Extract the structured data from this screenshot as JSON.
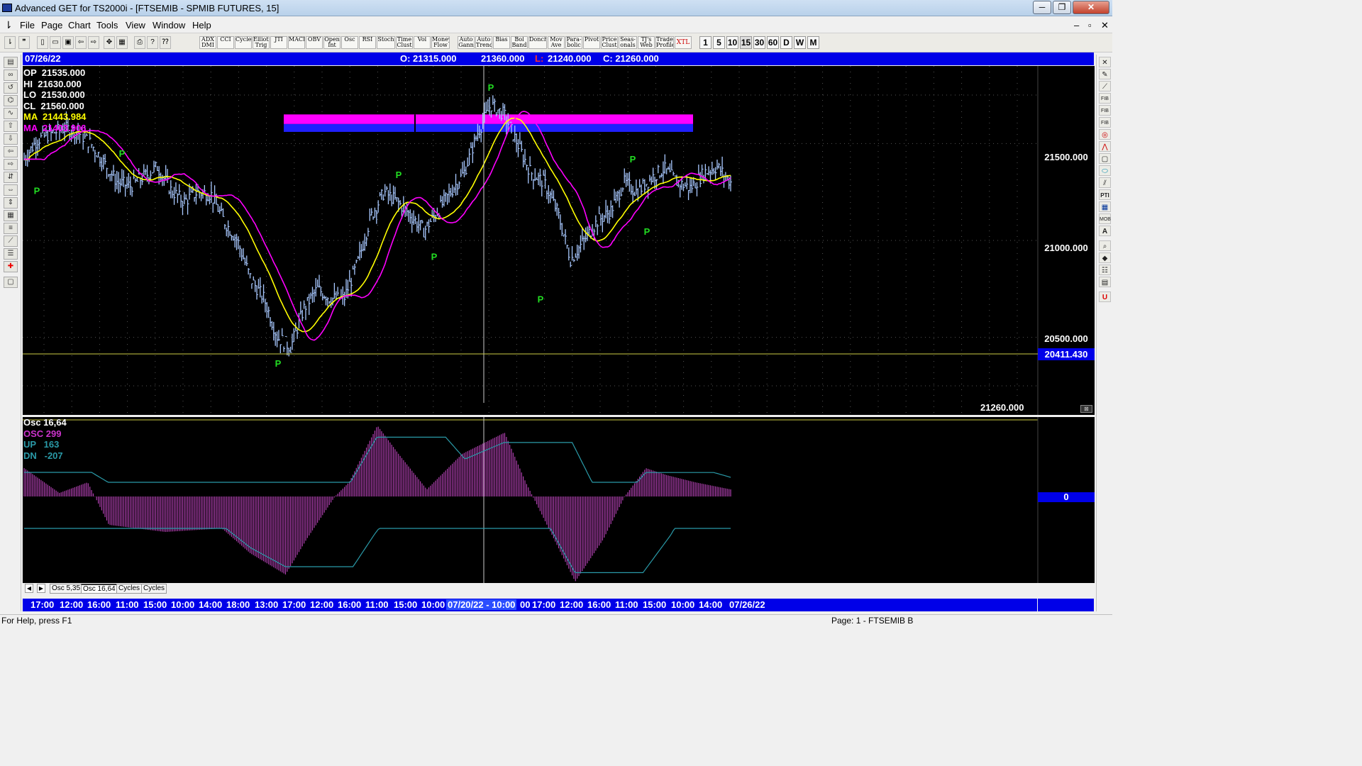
{
  "window": {
    "title": "Advanced GET for TS2000i - [FTSEMIB - SPMIB FUTURES, 15]",
    "controls": [
      "─",
      "❐",
      "✕"
    ]
  },
  "menu": [
    "File",
    "Page",
    "Chart",
    "Tools",
    "View",
    "Window",
    "Help"
  ],
  "mdi_controls": [
    "–",
    "▫",
    "✕"
  ],
  "toolbar": {
    "indicators": [
      "ADX DMI",
      "CCI",
      "Cycles",
      "Elliott Trig",
      "JTI",
      "MACD",
      "OBV",
      "Open Int",
      "Osc",
      "RSI",
      "Stoch",
      "Time Clust",
      "Vol",
      "Money Flow",
      "Auto Gann",
      "Auto Trend",
      "Bias",
      "Bol Band",
      "Donch",
      "Mov Ave",
      "Para-bolic",
      "Pivot",
      "Price Clust",
      "Seas-onals",
      "TJ's Web",
      "Trade Profile",
      "XTL"
    ],
    "timeframes": [
      "1",
      "5",
      "10",
      "15",
      "30",
      "60",
      "D",
      "W",
      "M"
    ]
  },
  "info_bar": {
    "date": "07/26/22",
    "open": "O: 21315.000",
    "high": "21360.000",
    "low_label": "L:",
    "low": "21240.000",
    "close": "C: 21260.000"
  },
  "price_legend": [
    {
      "label": "OP",
      "value": "21535.000",
      "color": "#ffffff"
    },
    {
      "label": "HI",
      "value": "21630.000",
      "color": "#ffffff"
    },
    {
      "label": "LO",
      "value": "21530.000",
      "color": "#ffffff"
    },
    {
      "label": "CL",
      "value": "21560.000",
      "color": "#ffffff"
    },
    {
      "label": "MA",
      "value": "21443.984",
      "color": "#ffff00"
    },
    {
      "label": "MA",
      "value": "21403.906",
      "color": "#ff00ff"
    }
  ],
  "price_axis": {
    "ticks": [
      "21500.000",
      "21000.000",
      "20500.000"
    ],
    "crosshair_value": "20411.430",
    "last_value": "21260.000"
  },
  "osc_legend": [
    {
      "text": "Osc 16,64",
      "color": "#ffffff"
    },
    {
      "text": "OSC 299",
      "color": "#cc33cc"
    },
    {
      "text": "UP   163",
      "color": "#2a9aa8"
    },
    {
      "text": "DN   -207",
      "color": "#2a9aa8"
    }
  ],
  "osc_axis": {
    "zero": "0"
  },
  "pivot_marker": "P",
  "tabs": [
    "Osc 5,35",
    "Osc 16,64",
    "Cycles",
    "Cycles"
  ],
  "time_axis": [
    "17:00",
    "12:00",
    "16:00",
    "11:00",
    "15:00",
    "10:00",
    "14:00",
    "18:00",
    "13:00",
    "17:00",
    "12:00",
    "16:00",
    "11:00",
    "15:00",
    "10:00",
    "07/20/22 - 10:00",
    "00",
    "17:00",
    "12:00",
    "16:00",
    "11:00",
    "15:00",
    "10:00",
    "14:00",
    "07/26/22"
  ],
  "statusbar": {
    "left": "For Help, press F1",
    "right": "Page: 1 - FTSEMIB B"
  },
  "colors": {
    "ma_fast": "#ffff00",
    "ma_slow": "#ff00ff",
    "bars": "#a8c8ff",
    "pivot": "#22dd22",
    "osc_hist": "#b040b0",
    "osc_bands": "#2a9aa8"
  },
  "chart_data": {
    "type": "line",
    "instrument": "FTSEMIB - SPMIB FUTURES",
    "interval": "15",
    "ylim": [
      20100,
      21900
    ],
    "y_ticks": [
      21500,
      21000,
      20500
    ],
    "price_path": [
      21420,
      21520,
      21550,
      21580,
      21560,
      21500,
      21400,
      21300,
      21280,
      21330,
      21380,
      21260,
      21200,
      21250,
      21240,
      21100,
      21000,
      20800,
      20700,
      20500,
      20450,
      20650,
      20750,
      20700,
      20700,
      20880,
      21120,
      21250,
      21200,
      21130,
      21050,
      21150,
      21250,
      21350,
      21550,
      21700,
      21650,
      21500,
      21350,
      21300,
      21150,
      20900,
      21000,
      21100,
      21150,
      21300,
      21250,
      21320,
      21370,
      21300,
      21270,
      21350,
      21380,
      21300
    ],
    "pivots": [
      {
        "x": 0.02,
        "price": 21320,
        "pos": "low"
      },
      {
        "x": 0.14,
        "price": 21410,
        "pos": "high"
      },
      {
        "x": 0.36,
        "price": 20430,
        "pos": "low"
      },
      {
        "x": 0.53,
        "price": 21300,
        "pos": "high"
      },
      {
        "x": 0.58,
        "price": 20980,
        "pos": "low"
      },
      {
        "x": 0.66,
        "price": 21750,
        "pos": "high"
      },
      {
        "x": 0.73,
        "price": 20760,
        "pos": "low"
      },
      {
        "x": 0.86,
        "price": 21380,
        "pos": "high"
      },
      {
        "x": 0.88,
        "price": 21110,
        "pos": "low"
      }
    ],
    "zone": {
      "top": 21650,
      "bottom": 21560
    }
  }
}
